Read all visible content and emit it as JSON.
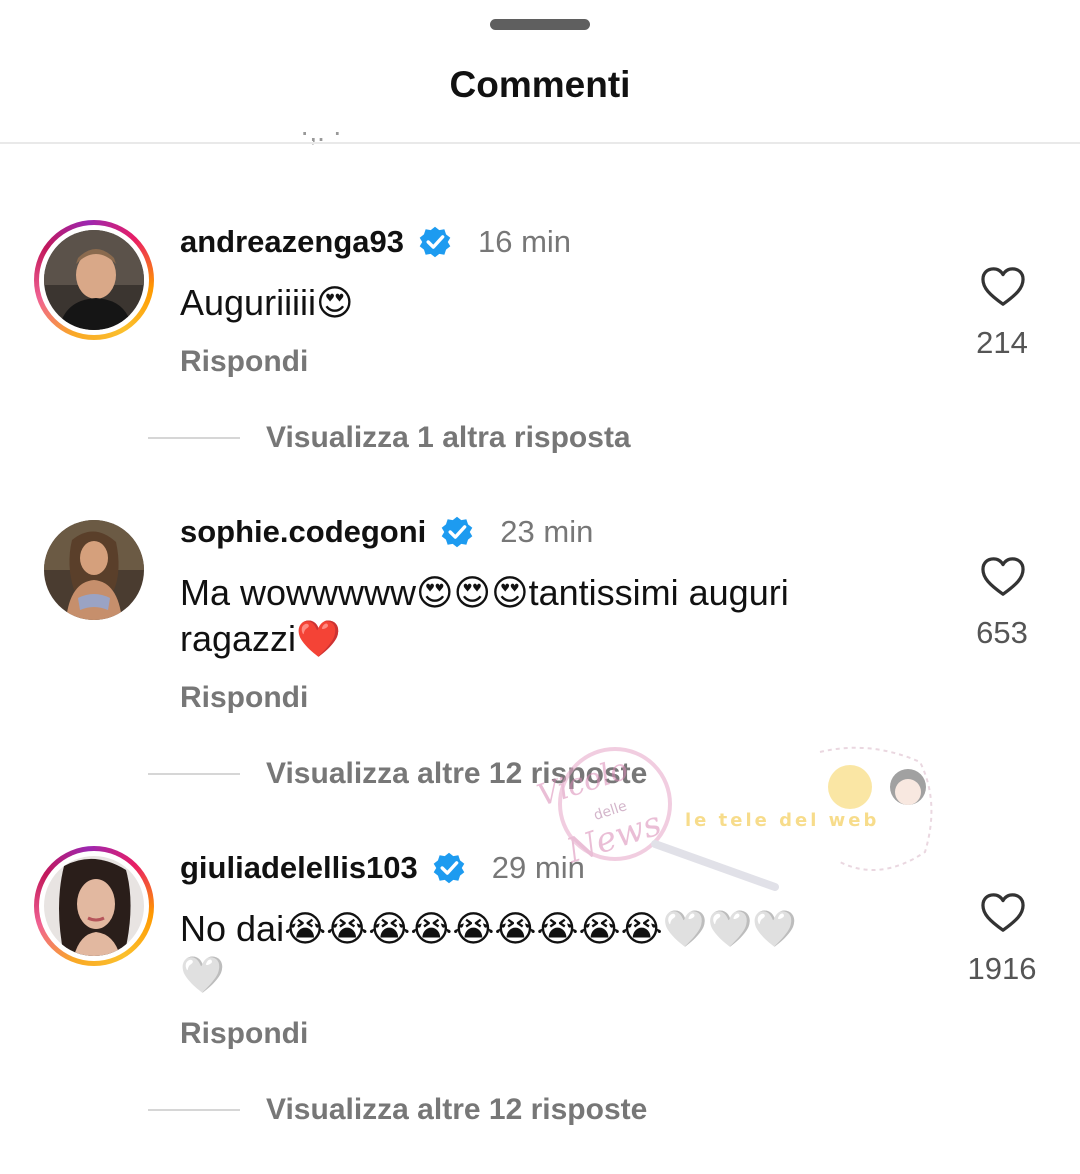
{
  "header": {
    "title": "Commenti"
  },
  "comments": [
    {
      "username": "andreazenga93",
      "time": "16 min",
      "text": "Auguriiiii😍",
      "reply": "Rispondi",
      "likes": "214",
      "view_replies": "Visualizza 1 altra risposta",
      "has_story_ring": true
    },
    {
      "username": "sophie.codegoni",
      "time": "23 min",
      "text_line1": "Ma wowwwww😍😍😍tantissimi auguri",
      "text_line2": "ragazzi❤️",
      "reply": "Rispondi",
      "likes": "653",
      "view_replies": "Visualizza altre 12 risposte",
      "has_story_ring": false
    },
    {
      "username": "giuliadelellis103",
      "time": "29 min",
      "text_line1": "No dai😭😭😭😭😭😭😭😭😭🤍🤍🤍",
      "text_line2": "🤍",
      "reply": "Rispondi",
      "likes": "1916",
      "view_replies": "Visualizza altre 12 risposte",
      "has_story_ring": true
    }
  ],
  "watermark": {
    "line1": "Vicolo",
    "line2": "delle",
    "line3": "News",
    "tag": "le tele del web"
  },
  "colors": {
    "verified": "#1d9bf0",
    "muted": "#777777",
    "divider": "#e9e9e9"
  }
}
